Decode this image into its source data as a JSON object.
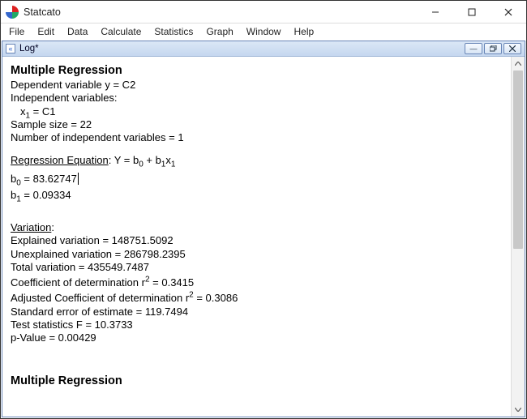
{
  "window": {
    "title": "Statcato"
  },
  "menu": {
    "file": "File",
    "edit": "Edit",
    "data": "Data",
    "calculate": "Calculate",
    "statistics": "Statistics",
    "graph": "Graph",
    "window": "Window",
    "help": "Help"
  },
  "child": {
    "title": "Log*"
  },
  "log": {
    "heading1": "Multiple Regression",
    "depvar": "Dependent variable y = C2",
    "indepvar_label": "Independent variables:",
    "indepvar_1_pre": "x",
    "indepvar_1_sub": "1",
    "indepvar_1_post": " = C1",
    "sample_size": "Sample size = 22",
    "num_ind": "Number of independent variables = 1",
    "eq_label": "Regression Equation",
    "eq_sep": ": ",
    "eq_body_1": "Y = b",
    "eq_body_s0": "0",
    "eq_body_2": " + b",
    "eq_body_s1": "1",
    "eq_body_3": "x",
    "eq_body_s1b": "1",
    "b0_pre": "b",
    "b0_sub": "0",
    "b0_val": " = 83.62747",
    "b1_pre": "b",
    "b1_sub": "1",
    "b1_val": " = 0.09334",
    "variation_label": "Variation",
    "variation_colon": ":",
    "exp_var": "Explained variation = 148751.5092",
    "unexp_var": "Unexplained variation = 286798.2395",
    "tot_var": "Total variation = 435549.7487",
    "r2_pre": "Coefficient of determination r",
    "r2_sup": "2",
    "r2_val": " = 0.3415",
    "ar2_pre": "Adjusted Coefficient of determination r",
    "ar2_sup": "2",
    "ar2_val": " = 0.3086",
    "se": "Standard error of estimate = 119.7494",
    "fstat": "Test statistics F = 10.3733",
    "pval": "p-Value = 0.00429",
    "heading2": "Multiple Regression"
  }
}
